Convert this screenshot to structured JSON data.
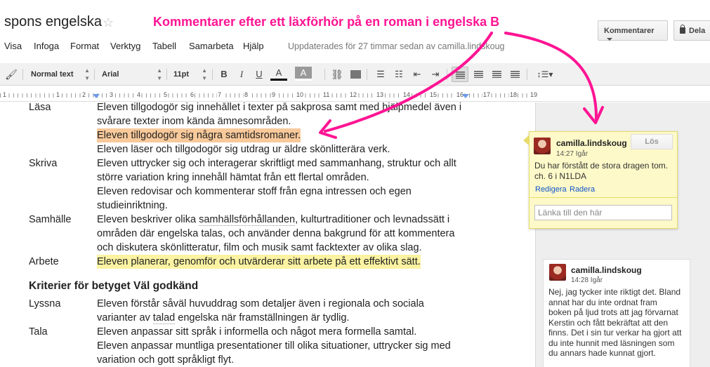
{
  "doc": {
    "title": "spons engelska",
    "updated": "Uppdaterades för 27 timmar sedan av camilla.lindskoug"
  },
  "annotation": "Kommentarer efter ett läxförhör på en roman i engelska B",
  "header_buttons": {
    "comments": "Kommentarer",
    "share": "Dela"
  },
  "menu": [
    "Visa",
    "Infoga",
    "Format",
    "Verktyg",
    "Tabell",
    "Samarbeta",
    "Hjälp"
  ],
  "toolbar": {
    "style": "Normal text",
    "font": "Arial",
    "size": "11pt",
    "bold": "B",
    "italic": "I",
    "underline": "U",
    "text_color": "A",
    "highlight": "A"
  },
  "ruler": [
    "1",
    "1",
    "2",
    "3",
    "4",
    "5",
    "6",
    "7",
    "8",
    "9",
    "10",
    "11",
    "12",
    "13",
    "14",
    "15",
    "16",
    "17",
    "18",
    "19"
  ],
  "body": {
    "row1": {
      "label": "Läsa",
      "text": "Eleven tillgodogör sig innehållet i texter på sakprosa samt med hjälpmedel även i"
    },
    "row2": {
      "text": "svårare texter inom kända ämnesområden."
    },
    "row3": {
      "text": "Eleven tillgodogör sig några samtidsromaner."
    },
    "row4": {
      "text": "Eleven läser och tillgodogör sig utdrag ur äldre skönlitterära verk."
    },
    "row5": {
      "label": "Skriva",
      "text": "Eleven uttrycker sig och interagerar skriftligt med sammanhang, struktur och allt"
    },
    "row6": {
      "text": "större variation kring innehåll hämtat från ett flertal områden."
    },
    "row7": {
      "text": "Eleven redovisar och kommenterar stoff från egna intressen och egen"
    },
    "row8": {
      "text": "studieinriktning."
    },
    "row9": {
      "label": "Samhälle",
      "text_pre": "Eleven beskriver olika ",
      "text_u": "samhällsförhållanden",
      "text_post": ", kulturtraditioner och levnadssätt i"
    },
    "row10": {
      "text": "områden där engelska talas, och använder denna bakgrund för att kommentera"
    },
    "row11": {
      "text": "och diskutera skönlitteratur, film och musik samt facktexter av olika slag."
    },
    "row12": {
      "label": "Arbete",
      "text": "Eleven planerar, genomför och utvärderar sitt arbete på ett effektivt sätt."
    },
    "heading": "Kriterier för betyget Väl godkänd",
    "row13": {
      "label": "Lyssna",
      "text": "Eleven förstår såväl huvuddrag som detaljer även i regionala och sociala"
    },
    "row14": {
      "text_pre": "varianter av ",
      "text_u": "talad",
      "text_post": " engelska när framställningen är tydlig."
    },
    "row15": {
      "label": "Tala",
      "text": "Eleven anpassar sitt språk i informella och något mera formella samtal."
    },
    "row16": {
      "text": "Eleven anpassar muntliga presentationer till olika situationer, uttrycker sig med"
    },
    "row17": {
      "text": "variation och gott språkligt flyt."
    }
  },
  "comments": [
    {
      "author": "camilla.lindskoug",
      "time": "14:27 Igår",
      "resolve": "Lös",
      "body": "Du har förstått de stora dragen tom. ch. 6 i N1LDA",
      "edit": "Redigera",
      "delete": "Radera",
      "link_placeholder": "Länka till den här"
    },
    {
      "author": "camilla.lindskoug",
      "time": "14:28 Igår",
      "body": "Nej, jag tycker inte riktigt det. Bland annat har du inte ordnat fram boken på ljud trots att jag förvarnat Kerstin och fått bekräftat att den finns. Det i sin tur verkar ha gjort att du inte hunnit med läsningen som du annars hade kunnat gjort."
    }
  ],
  "colors": {
    "annotation": "#ff1493",
    "highlight_orange": "#f8c99a",
    "highlight_yellow": "#fbf3a2",
    "comment_active_bg": "#fdf9c8"
  },
  "icons": [
    "star-icon",
    "lock-icon",
    "paint-format-icon",
    "link-icon",
    "image-icon",
    "numbered-list-icon",
    "bulleted-list-icon",
    "indent-icon",
    "align-left-icon",
    "line-spacing-icon"
  ]
}
